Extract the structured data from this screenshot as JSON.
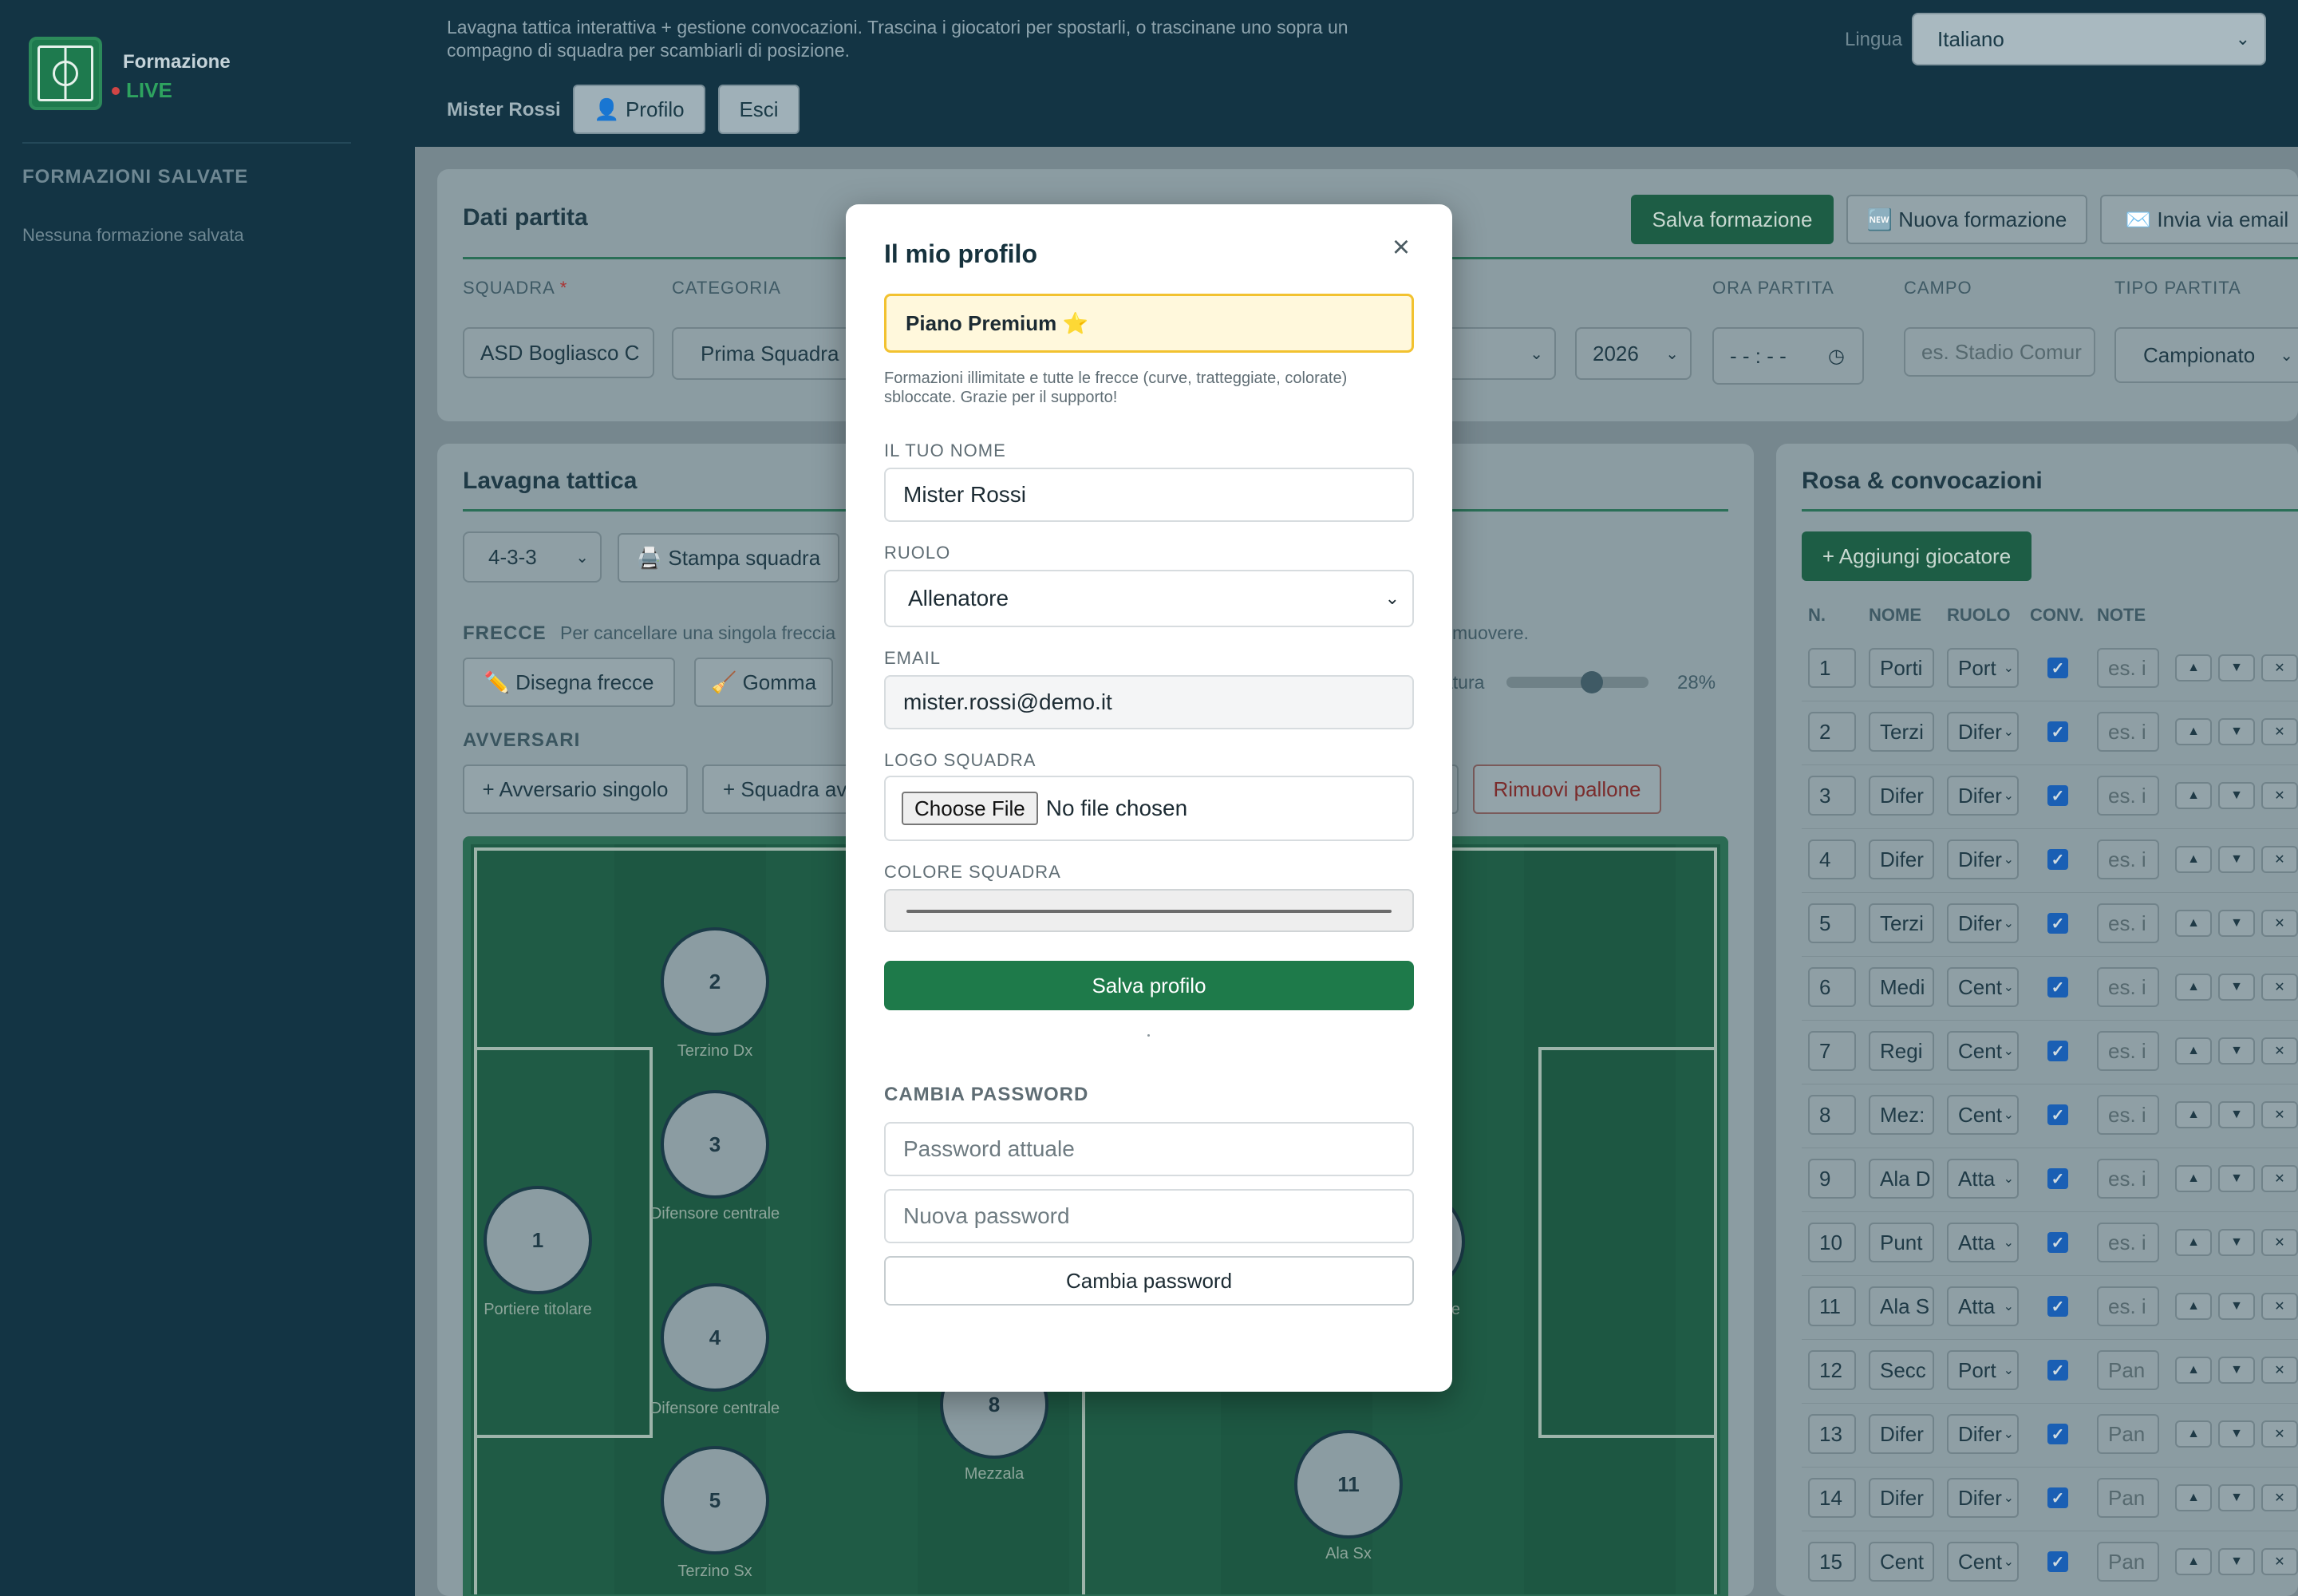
{
  "sidebar": {
    "brand_name": "Formazione",
    "brand_live": "LIVE",
    "heading": "FORMAZIONI SALVATE",
    "empty": "Nessuna formazione salvata"
  },
  "header": {
    "description": "Lavagna tattica interattiva + gestione convocazioni. Trascina i giocatori per spostarli, o trascinane uno sopra un compagno di squadra per scambiarli di posizione.",
    "user": "Mister Rossi",
    "profile_btn": "👤 Profilo",
    "logout_btn": "Esci",
    "lang_label": "Lingua",
    "lang_value": "Italiano"
  },
  "match": {
    "title": "Dati partita",
    "save_btn": "Salva formazione",
    "new_btn": "🆕 Nuova formazione",
    "email_btn": "✉️ Invia via email",
    "squadra_label": "SQUADRA",
    "squadra_req": "*",
    "squadra_value": "ASD Bogliasco C",
    "categoria_label": "CATEGORIA",
    "categoria_value": "Prima Squadra",
    "year_value": "2026",
    "ora_label": "ORA PARTITA",
    "ora_value": "- - : - -",
    "campo_label": "CAMPO",
    "campo_placeholder": "es. Stadio Comur",
    "tipo_label": "TIPO PARTITA",
    "tipo_value": "Campionato"
  },
  "board": {
    "title": "Lavagna tattica",
    "formation": "4-3-3",
    "print_btn": "🖨️ Stampa squadra",
    "arrows_label": "FRECCE",
    "arrows_help": "Per cancellare una singola freccia",
    "arrows_help_tail": "muovere.",
    "draw_btn": "✏️ Disegna frecce",
    "eraser_btn": "🧹 Gomma",
    "thickness_label": "atura",
    "thickness_pct": "28%",
    "thickness_value": 0.6,
    "opponents_label": "AVVERSARI",
    "single_opp_btn": "+ Avversario singolo",
    "team_opp_btn": "+ Squadra av",
    "remove_ball_btn": "Rimuovi pallone"
  },
  "players": [
    {
      "num": "1",
      "label": "Portiere titolare"
    },
    {
      "num": "2",
      "label": "Terzino Dx"
    },
    {
      "num": "3",
      "label": "Difensore centrale"
    },
    {
      "num": "4",
      "label": "Difensore centrale"
    },
    {
      "num": "5",
      "label": "Terzino Sx"
    },
    {
      "num": "8",
      "label": "Mezzala"
    },
    {
      "num": "11",
      "label": "Ala Sx"
    },
    {
      "label": "e"
    }
  ],
  "roster": {
    "title": "Rosa & convocazioni",
    "add_btn": "+ Aggiungi giocatore",
    "cols": [
      "N.",
      "NOME",
      "RUOLO",
      "CONV.",
      "NOTE"
    ],
    "rows": [
      {
        "n": "1",
        "name": "Porti",
        "role": "Port",
        "note": "es. i"
      },
      {
        "n": "2",
        "name": "Terzi",
        "role": "Difer",
        "note": "es. i"
      },
      {
        "n": "3",
        "name": "Difer",
        "role": "Difer",
        "note": "es. i"
      },
      {
        "n": "4",
        "name": "Difer",
        "role": "Difer",
        "note": "es. i"
      },
      {
        "n": "5",
        "name": "Terzi",
        "role": "Difer",
        "note": "es. i"
      },
      {
        "n": "6",
        "name": "Medi",
        "role": "Cent",
        "note": "es. i"
      },
      {
        "n": "7",
        "name": "Regi",
        "role": "Cent",
        "note": "es. i"
      },
      {
        "n": "8",
        "name": "Mez:",
        "role": "Cent",
        "note": "es. i"
      },
      {
        "n": "9",
        "name": "Ala D",
        "role": "Atta",
        "note": "es. i"
      },
      {
        "n": "10",
        "name": "Punt",
        "role": "Atta",
        "note": "es. i"
      },
      {
        "n": "11",
        "name": "Ala S",
        "role": "Atta",
        "note": "es. i"
      },
      {
        "n": "12",
        "name": "Secc",
        "role": "Port",
        "note": "Pan"
      },
      {
        "n": "13",
        "name": "Difer",
        "role": "Difer",
        "note": "Pan"
      },
      {
        "n": "14",
        "name": "Difer",
        "role": "Difer",
        "note": "Pan"
      },
      {
        "n": "15",
        "name": "Cent",
        "role": "Cent",
        "note": "Pan"
      }
    ],
    "up": "▲",
    "down": "▼",
    "remove": "✕"
  },
  "modal": {
    "title": "Il mio profilo",
    "close": "×",
    "plan": "Piano Premium ⭐",
    "plan_note": "Formazioni illimitate e tutte le frecce (curve, tratteggiate, colorate) sbloccate. Grazie per il supporto!",
    "name_label": "IL TUO NOME",
    "name_value": "Mister Rossi",
    "role_label": "RUOLO",
    "role_value": "Allenatore",
    "email_label": "EMAIL",
    "email_value": "mister.rossi@demo.it",
    "logo_label": "LOGO SQUADRA",
    "file_btn": "Choose File",
    "file_status": "No file chosen",
    "color_label": "COLORE SQUADRA",
    "save_btn": "Salva profilo",
    "password_heading": "CAMBIA PASSWORD",
    "current_pw_placeholder": "Password attuale",
    "new_pw_placeholder": "Nuova password",
    "change_pw_btn": "Cambia password"
  },
  "colors": {
    "accent_green": "#1e7a4a",
    "premium_bg": "#fff8dc",
    "premium_border": "#f2c230",
    "sidebar_bg": "#133444"
  },
  "icons": {
    "logo": "pitch-logo-icon",
    "close": "close-icon",
    "chevron": "chevron-down-icon"
  }
}
